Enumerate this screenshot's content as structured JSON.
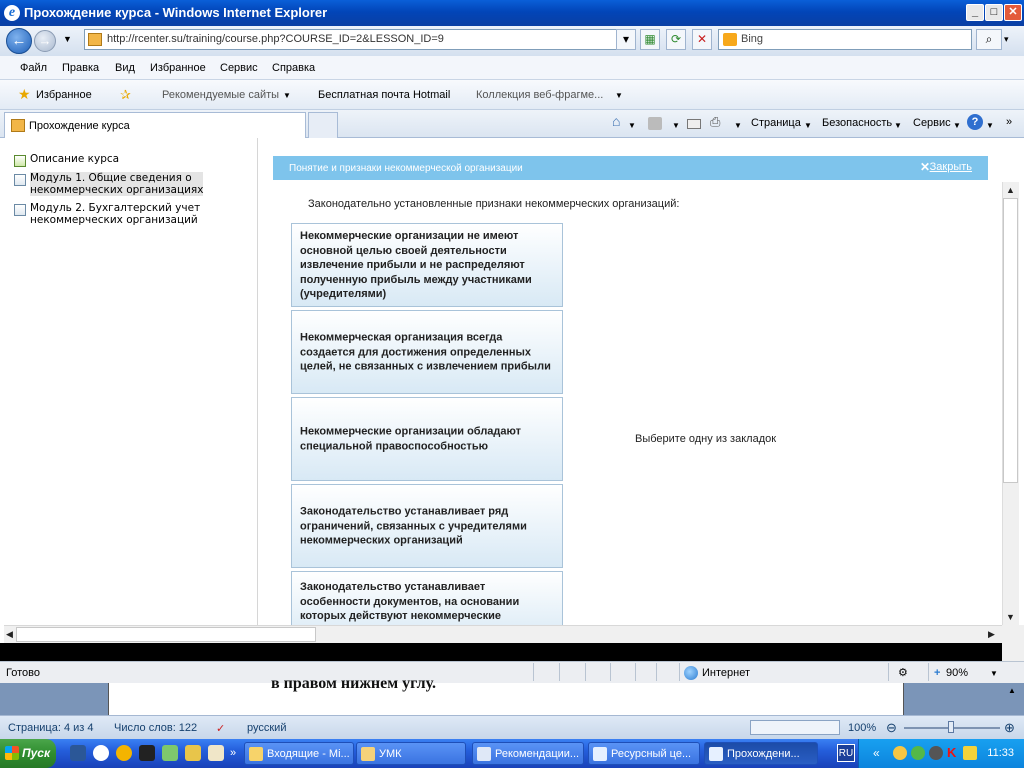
{
  "window": {
    "title": "Прохождение курса - Windows Internet Explorer"
  },
  "address": {
    "url": "http://rcenter.su/training/course.php?COURSE_ID=2&LESSON_ID=9"
  },
  "search": {
    "provider": "Bing"
  },
  "menu": [
    "Файл",
    "Правка",
    "Вид",
    "Избранное",
    "Сервис",
    "Справка"
  ],
  "favorites": {
    "label": "Избранное",
    "items": [
      "Рекомендуемые сайты",
      "Бесплатная почта Hotmail",
      "Коллекция веб-фрагме..."
    ]
  },
  "tab": {
    "title": "Прохождение курса"
  },
  "commandbar": [
    "Страница",
    "Безопасность",
    "Сервис"
  ],
  "left_nav": [
    {
      "label": "Описание курса"
    },
    {
      "label": "Модуль 1. Общие сведения о\nнекоммерческих организациях"
    },
    {
      "label": "Модуль 2. Бухгалтерский учет\nнекоммерческих организаций"
    }
  ],
  "lesson": {
    "title": "Понятие и признаки некоммерческой организации",
    "close_label": "Закрыть",
    "heading": "Законодательно установленные признаки некоммерческих организаций:",
    "cards": [
      "Некоммерческие организации не имеют основной целью своей деятельности извлечение прибыли и не распределяют полученную прибыль между участниками (учредителями)",
      "Некоммерческая организация всегда создается для достижения определенных целей, не связанных с извлечением прибыли",
      "Некоммерческие организации обладают специальной правоспособностью",
      "Законодательство устанавливает ряд ограничений, связанных с учредителями некоммерческих организаций",
      "Законодательство устанавливает особенности документов, на основании которых действуют некоммерческие организации"
    ],
    "hint": "Выберите одну из закладок"
  },
  "status": {
    "ready": "Готово",
    "zone": "Интернет",
    "zoom": "90%"
  },
  "word": {
    "peek_text": "в правом нижнем углу.",
    "page": "Страница: 4 из 4",
    "words": "Число слов: 122",
    "lang": "русский",
    "zoom": "100%"
  },
  "taskbar": {
    "start": "Пуск",
    "tasks": [
      "Входящие - Mi...",
      "УМК",
      "Рекомендации...",
      "Ресурсный це...",
      "Прохождени..."
    ],
    "lang": "RU",
    "clock": "11:33"
  },
  "colors": {
    "titlebar": "#0245b8",
    "infobar": "#7ec4ec",
    "taskbar": "#245edb",
    "start": "#2f8d2f"
  }
}
